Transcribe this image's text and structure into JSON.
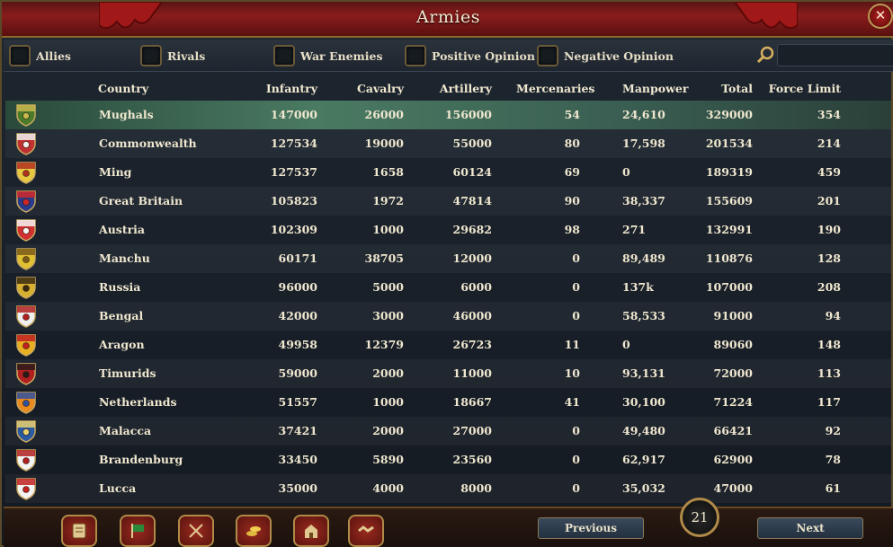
{
  "window": {
    "title": "Armies"
  },
  "filters": [
    {
      "label": "Allies"
    },
    {
      "label": "Rivals"
    },
    {
      "label": "War Enemies"
    },
    {
      "label": "Positive Opinion"
    },
    {
      "label": "Negative Opinion"
    }
  ],
  "columns": [
    "Country",
    "Infantry",
    "Cavalry",
    "Artillery",
    "Mercenaries",
    "Manpower",
    "Total",
    "Force Limit"
  ],
  "rows": [
    {
      "country": "Mughals",
      "infantry": "147000",
      "cavalry": "26000",
      "artillery": "156000",
      "mercenaries": "54",
      "manpower": "24,610",
      "total": "329000",
      "force_limit": "354",
      "flag_colors": [
        "#4a7a2a",
        "#c8b850"
      ],
      "selected": true
    },
    {
      "country": "Commonwealth",
      "infantry": "127534",
      "cavalry": "19000",
      "artillery": "55000",
      "mercenaries": "80",
      "manpower": "17,598",
      "total": "201534",
      "force_limit": "214",
      "flag_colors": [
        "#c03030",
        "#f0f0f0"
      ]
    },
    {
      "country": "Ming",
      "infantry": "127537",
      "cavalry": "1658",
      "artillery": "60124",
      "mercenaries": "69",
      "manpower": "0",
      "total": "189319",
      "force_limit": "459",
      "flag_colors": [
        "#e8c840",
        "#b03020"
      ]
    },
    {
      "country": "Great Britain",
      "infantry": "105823",
      "cavalry": "1972",
      "artillery": "47814",
      "mercenaries": "90",
      "manpower": "38,337",
      "total": "155609",
      "force_limit": "201",
      "flag_colors": [
        "#2a3a8a",
        "#d02828"
      ]
    },
    {
      "country": "Austria",
      "infantry": "102309",
      "cavalry": "1000",
      "artillery": "29682",
      "mercenaries": "98",
      "manpower": "271",
      "total": "132991",
      "force_limit": "190",
      "flag_colors": [
        "#d03030",
        "#f4f4f4"
      ]
    },
    {
      "country": "Manchu",
      "infantry": "60171",
      "cavalry": "38705",
      "artillery": "12000",
      "mercenaries": "0",
      "manpower": "89,489",
      "total": "110876",
      "force_limit": "128",
      "flag_colors": [
        "#e0c030",
        "#7a5a1a"
      ]
    },
    {
      "country": "Russia",
      "infantry": "96000",
      "cavalry": "5000",
      "artillery": "6000",
      "mercenaries": "0",
      "manpower": "137k",
      "total": "107000",
      "force_limit": "208",
      "flag_colors": [
        "#d8b030",
        "#3a2a10"
      ]
    },
    {
      "country": "Bengal",
      "infantry": "42000",
      "cavalry": "3000",
      "artillery": "46000",
      "mercenaries": "0",
      "manpower": "58,533",
      "total": "91000",
      "force_limit": "94",
      "flag_colors": [
        "#f0f0f0",
        "#b02020"
      ]
    },
    {
      "country": "Aragon",
      "infantry": "49958",
      "cavalry": "12379",
      "artillery": "26723",
      "mercenaries": "11",
      "manpower": "0",
      "total": "89060",
      "force_limit": "148",
      "flag_colors": [
        "#e8b020",
        "#c02020"
      ]
    },
    {
      "country": "Timurids",
      "infantry": "59000",
      "cavalry": "2000",
      "artillery": "11000",
      "mercenaries": "10",
      "manpower": "93,131",
      "total": "72000",
      "force_limit": "113",
      "flag_colors": [
        "#b02020",
        "#2a1a1a"
      ]
    },
    {
      "country": "Netherlands",
      "infantry": "51557",
      "cavalry": "1000",
      "artillery": "18667",
      "mercenaries": "41",
      "manpower": "30,100",
      "total": "71224",
      "force_limit": "117",
      "flag_colors": [
        "#e88a20",
        "#3050a0"
      ]
    },
    {
      "country": "Malacca",
      "infantry": "37421",
      "cavalry": "2000",
      "artillery": "27000",
      "mercenaries": "0",
      "manpower": "49,480",
      "total": "66421",
      "force_limit": "92",
      "flag_colors": [
        "#2a5aa0",
        "#e8d070"
      ]
    },
    {
      "country": "Brandenburg",
      "infantry": "33450",
      "cavalry": "5890",
      "artillery": "23560",
      "mercenaries": "0",
      "manpower": "62,917",
      "total": "62900",
      "force_limit": "78",
      "flag_colors": [
        "#f4f4f4",
        "#b02020"
      ]
    },
    {
      "country": "Lucca",
      "infantry": "35000",
      "cavalry": "4000",
      "artillery": "8000",
      "mercenaries": "0",
      "manpower": "35,032",
      "total": "47000",
      "force_limit": "61",
      "flag_colors": [
        "#f4f4f4",
        "#c02020"
      ]
    }
  ],
  "toolbar": {
    "buttons": [
      "ledger-icon",
      "flag-icon",
      "crossed-swords-icon",
      "coins-icon",
      "buildings-icon",
      "handshake-icon"
    ]
  },
  "pagination": {
    "previous_label": "Previous",
    "next_label": "Next",
    "page": "21"
  },
  "colors": {
    "accent_red": "#8a1c1c",
    "gold_trim": "#b08a48",
    "selected_row": "#4a7a62"
  }
}
